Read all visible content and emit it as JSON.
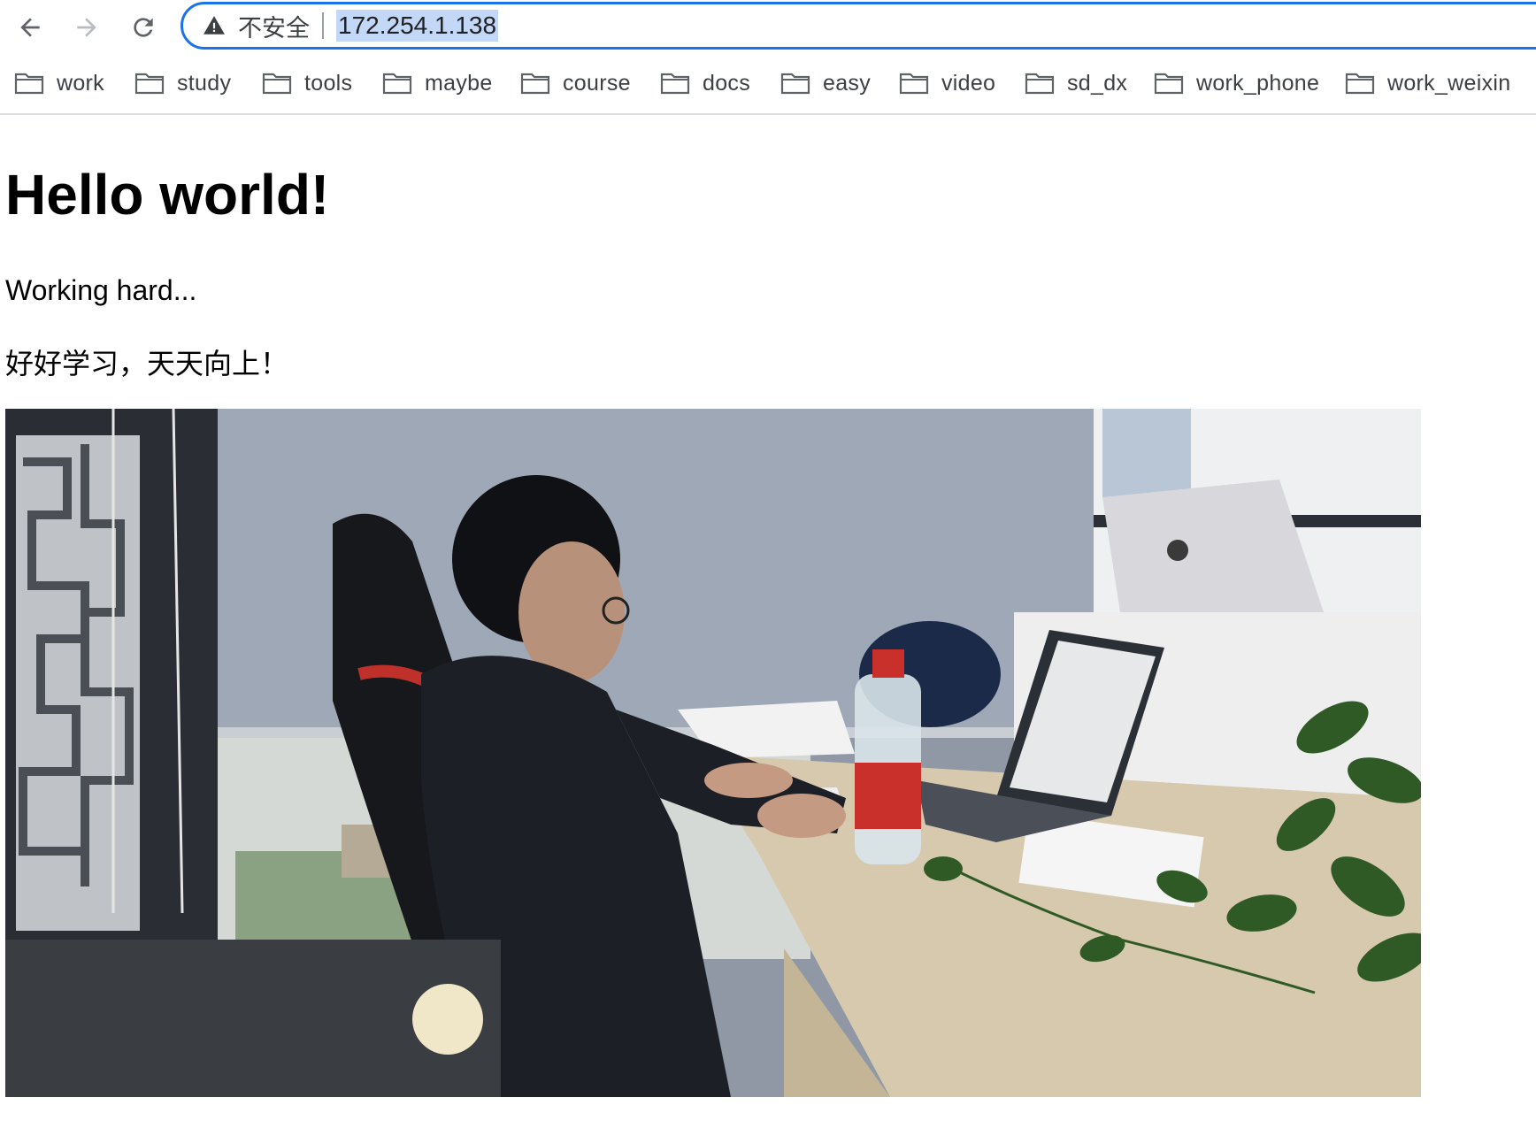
{
  "browser": {
    "back_icon": "arrow-left-icon",
    "forward_icon": "arrow-right-icon",
    "reload_icon": "reload-icon",
    "security_icon": "warning-triangle-icon",
    "security_label": "不安全",
    "url": "172.254.1.138"
  },
  "bookmarks": [
    {
      "label": "work",
      "icon": "folder-icon"
    },
    {
      "label": "study",
      "icon": "folder-icon"
    },
    {
      "label": "tools",
      "icon": "folder-icon"
    },
    {
      "label": "maybe",
      "icon": "folder-icon"
    },
    {
      "label": "course",
      "icon": "folder-icon"
    },
    {
      "label": "docs",
      "icon": "folder-icon"
    },
    {
      "label": "easy",
      "icon": "folder-icon"
    },
    {
      "label": "video",
      "icon": "folder-icon"
    },
    {
      "label": "sd_dx",
      "icon": "folder-icon"
    },
    {
      "label": "work_phone",
      "icon": "folder-icon"
    },
    {
      "label": "work_weixin",
      "icon": "folder-icon"
    }
  ],
  "page": {
    "heading": "Hello world!",
    "paragraph1": "Working hard...",
    "paragraph2": "好好学习，天天向上！"
  },
  "colors": {
    "omnibox_border": "#1a73e8",
    "url_highlight": "#c3d7f6"
  }
}
